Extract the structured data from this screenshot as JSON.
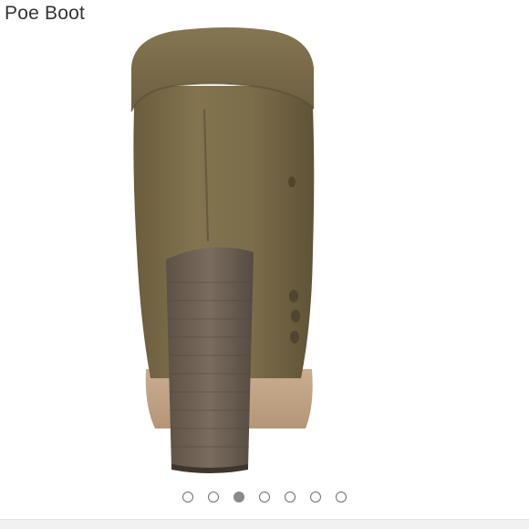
{
  "product": {
    "title": "Poe Boot"
  },
  "gallery": {
    "image_name": "boot-back-view",
    "slide_count": 7,
    "active_index": 2
  },
  "colors": {
    "suede": "#7a6c49",
    "heel": "#6f6255",
    "sole": "#c5a98c",
    "dot_active": "#8a8a8a",
    "dot_border": "#6f6f6f"
  }
}
